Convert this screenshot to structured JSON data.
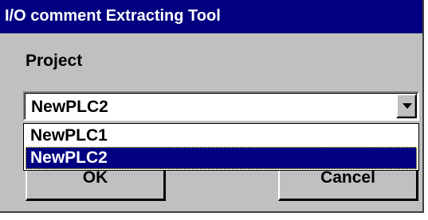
{
  "window": {
    "title": "I/O comment Extracting Tool",
    "title_bg": "#000080",
    "title_fg": "#ffffff",
    "face_color": "#c0c0c0"
  },
  "form": {
    "project_label": "Project",
    "project_value": "NewPLC2",
    "dropdown_icon": "chevron-down-icon",
    "options": [
      "NewPLC1",
      "NewPLC2"
    ],
    "selected_option": "NewPLC2",
    "selection_bg": "#000080"
  },
  "buttons": {
    "ok_label": "OK",
    "cancel_label": "Cancel"
  }
}
